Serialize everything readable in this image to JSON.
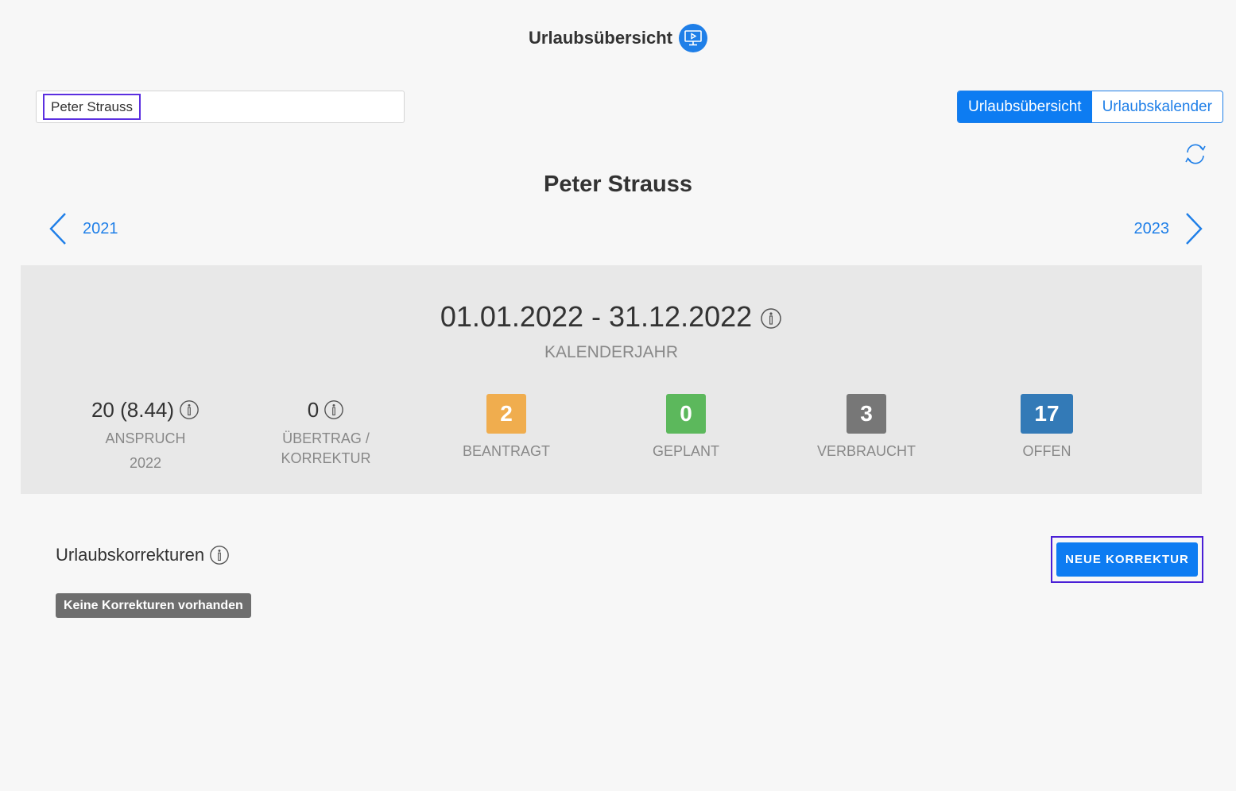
{
  "header": {
    "title": "Urlaubsübersicht",
    "icon": "monitor-play-icon"
  },
  "search": {
    "value": "Peter Strauss"
  },
  "view_toggle": {
    "active_label": "Urlaubsübersicht",
    "inactive_label": "Urlaubskalender"
  },
  "person": {
    "name": "Peter Strauss"
  },
  "year_nav": {
    "prev": "2021",
    "next": "2023"
  },
  "period": {
    "range": "01.01.2022 - 31.12.2022",
    "type": "KALENDERJAHR"
  },
  "stats": {
    "anspruch": {
      "value": "20 (8.44)",
      "label": "ANSPRUCH",
      "sublabel": "2022"
    },
    "uebertrag": {
      "value": "0",
      "label_line1": "ÜBERTRAG /",
      "label_line2": "KORREKTUR"
    },
    "beantragt": {
      "value": "2",
      "label": "BEANTRAGT",
      "color": "#f0ad4e"
    },
    "geplant": {
      "value": "0",
      "label": "GEPLANT",
      "color": "#5cb85c"
    },
    "verbraucht": {
      "value": "3",
      "label": "VERBRAUCHT",
      "color": "#777777"
    },
    "offen": {
      "value": "17",
      "label": "OFFEN",
      "color": "#337ab7"
    }
  },
  "korrekturen": {
    "title": "Urlaubskorrekturen",
    "empty_text": "Keine Korrekturen vorhanden",
    "new_button": "NEUE KORREKTUR"
  },
  "colors": {
    "primary": "#0d7cf2",
    "panel": "#e8e8e8"
  }
}
